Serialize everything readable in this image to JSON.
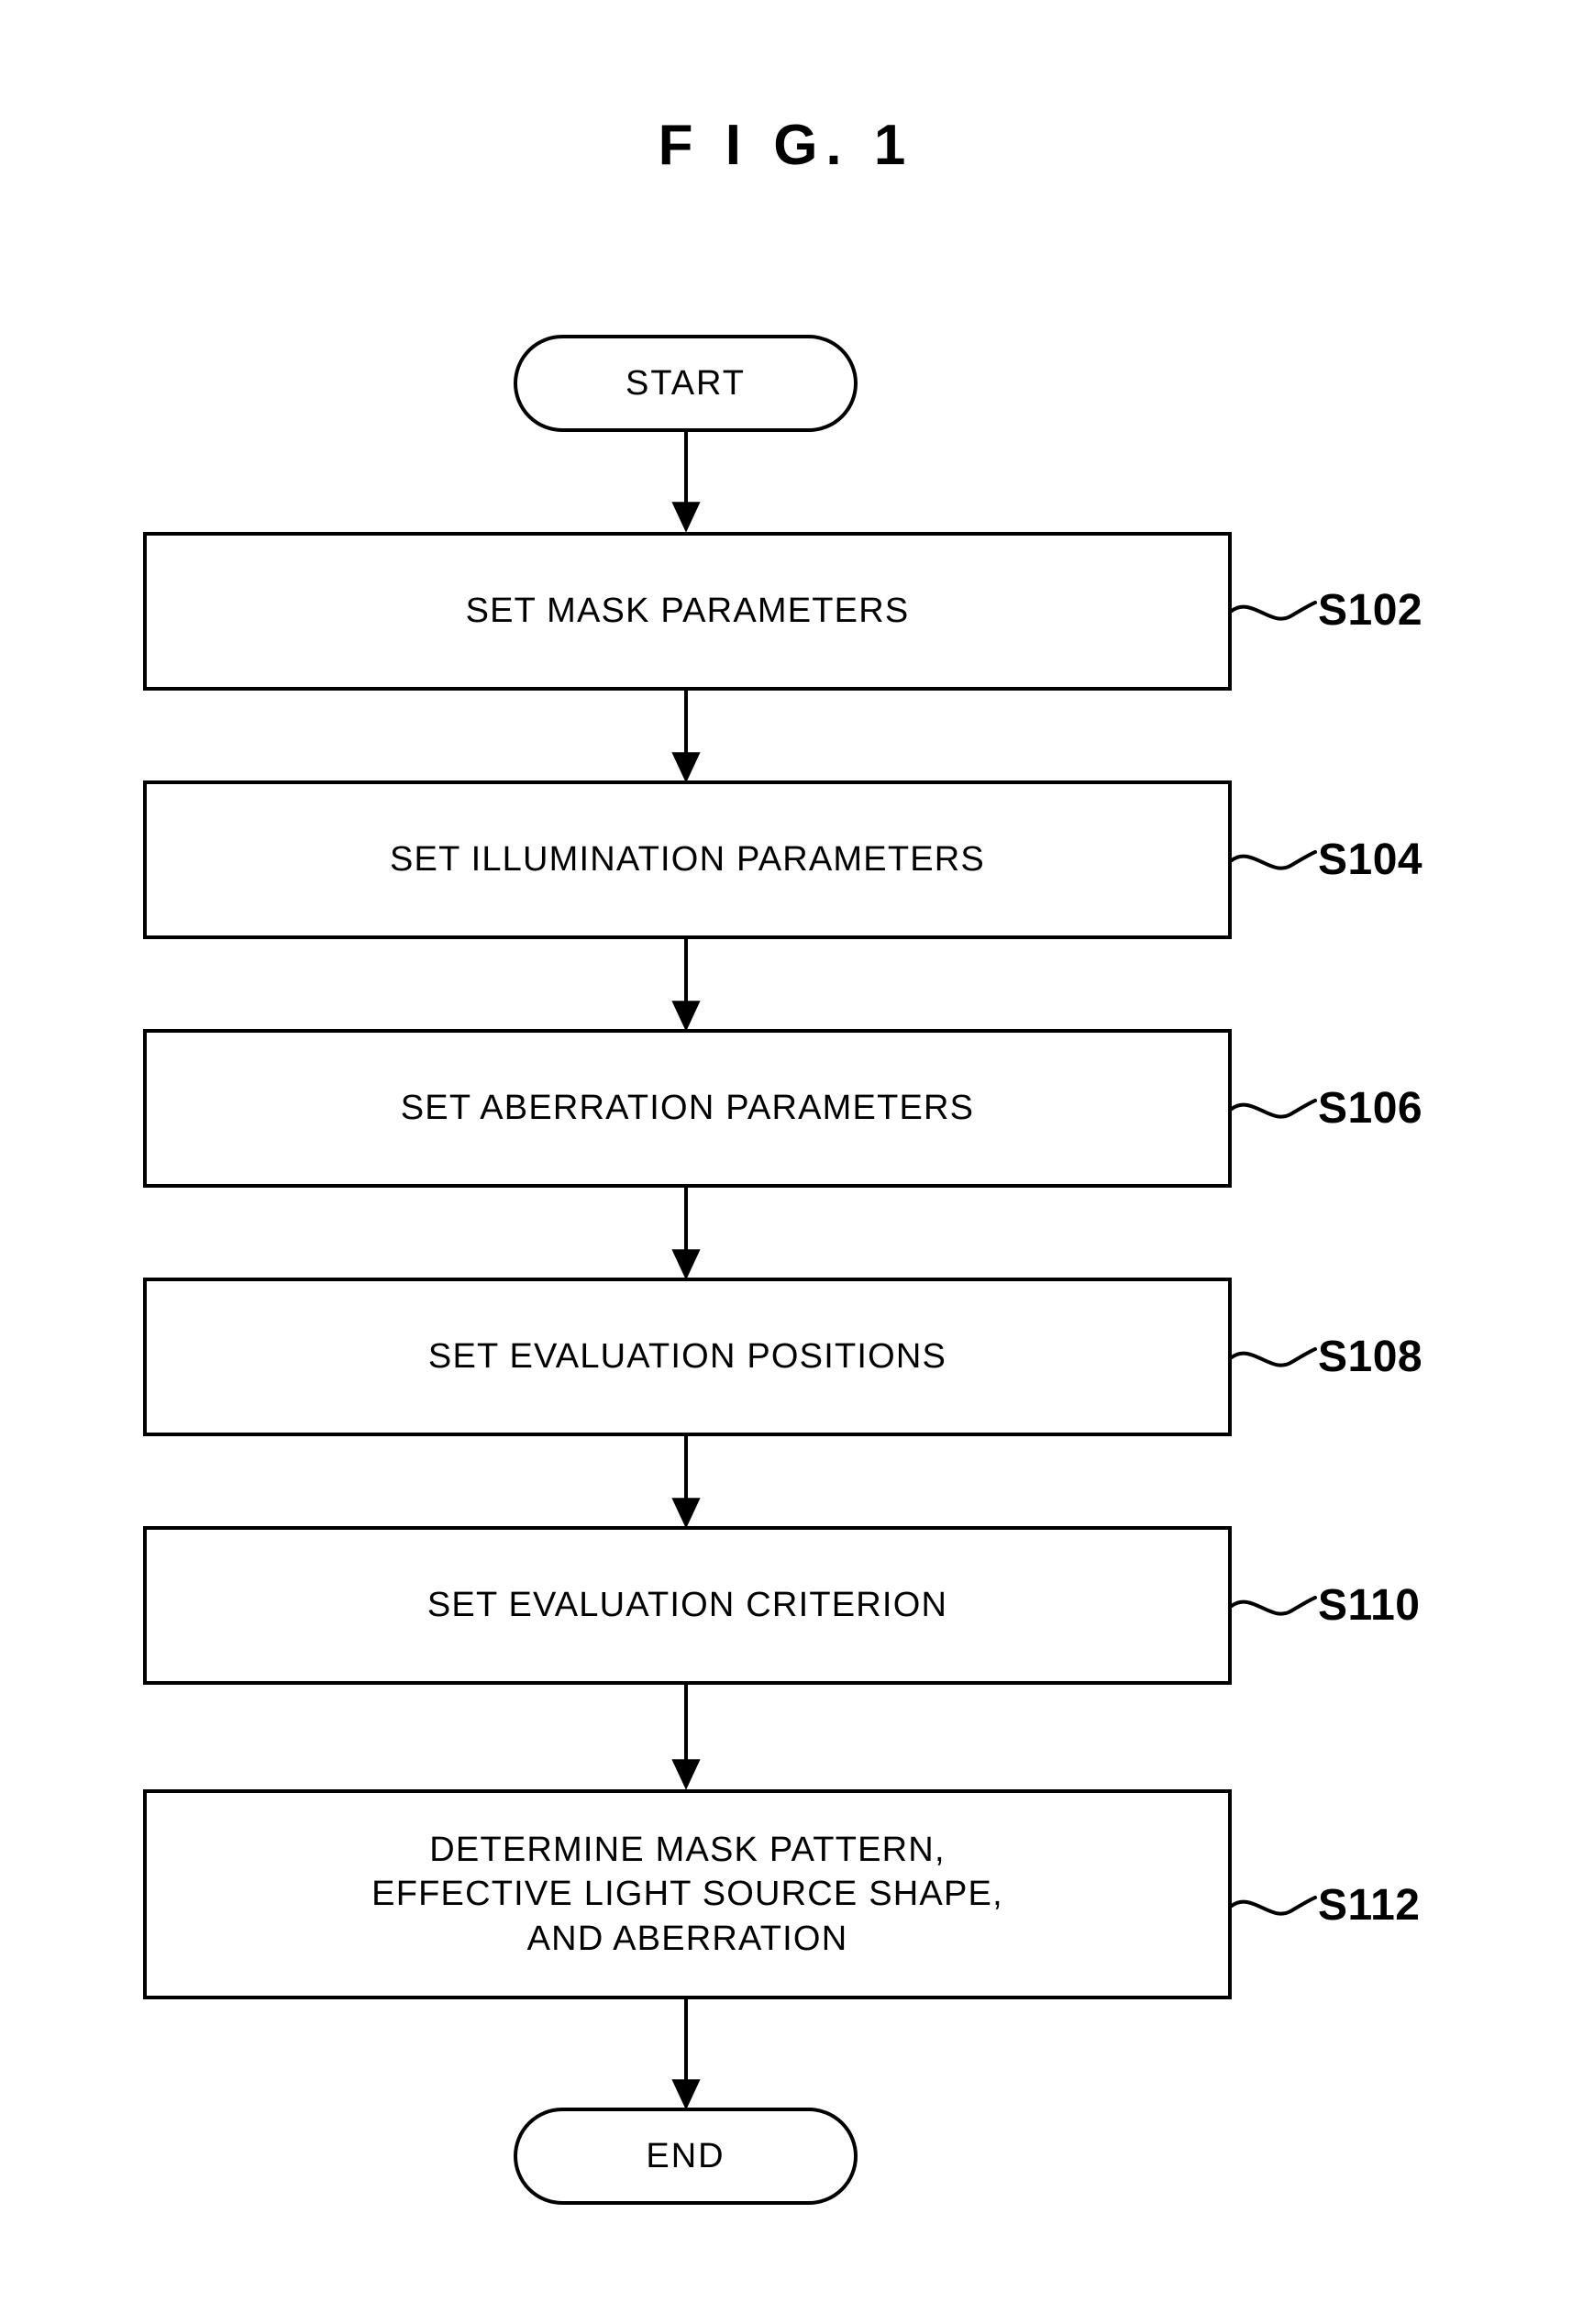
{
  "figure": {
    "title": "F I G.  1"
  },
  "flowchart": {
    "start": {
      "label": "START",
      "shape": "terminator"
    },
    "end": {
      "label": "END",
      "shape": "terminator"
    },
    "steps": [
      {
        "id": "S102",
        "label": "SET MASK PARAMETERS",
        "tag": "S102"
      },
      {
        "id": "S104",
        "label": "SET ILLUMINATION PARAMETERS",
        "tag": "S104"
      },
      {
        "id": "S106",
        "label": "SET ABERRATION PARAMETERS",
        "tag": "S106"
      },
      {
        "id": "S108",
        "label": "SET EVALUATION POSITIONS",
        "tag": "S108"
      },
      {
        "id": "S110",
        "label": "SET EVALUATION CRITERION",
        "tag": "S110"
      },
      {
        "id": "S112",
        "label": "DETERMINE MASK PATTERN,\nEFFECTIVE LIGHT SOURCE SHAPE,\nAND ABERRATION",
        "tag": "S112"
      }
    ],
    "colors": {
      "line": "#000000",
      "fill": "#ffffff"
    }
  }
}
